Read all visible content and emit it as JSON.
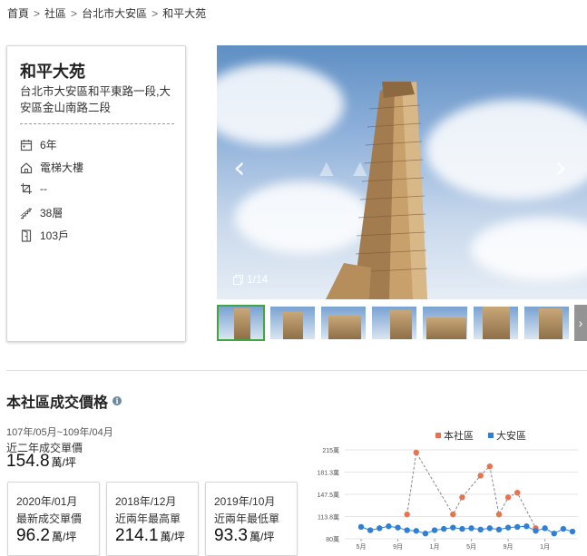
{
  "breadcrumb": [
    {
      "label": "首頁"
    },
    {
      "label": "社區"
    },
    {
      "label": "台北市大安區"
    },
    {
      "label": "和平大苑"
    }
  ],
  "breadcrumb_sep": ">",
  "community": {
    "name": "和平大苑",
    "address": "台北市大安區和平東路一段,大安區金山南路二段",
    "attributes": [
      {
        "icon": "calendar-icon",
        "value": "6年"
      },
      {
        "icon": "house-icon",
        "value": "電梯大樓"
      },
      {
        "icon": "crop-icon",
        "value": "--"
      },
      {
        "icon": "stairs-icon",
        "value": "38層"
      },
      {
        "icon": "door-icon",
        "value": "103戶"
      }
    ]
  },
  "gallery": {
    "counter": "1/14",
    "prev_icon": "chevron-left-icon",
    "next_icon": "chevron-right-icon",
    "thumbnail_count": 7
  },
  "price_section": {
    "title": "本社區成交價格",
    "period": "107年/05月~109年/04月",
    "recent_label": "近二年成交單價",
    "recent_value": "154.8",
    "unit": "萬/坪",
    "boxes": [
      {
        "date": "2020年/01月",
        "label": "最新成交單價",
        "value": "96.2"
      },
      {
        "date": "2018年/12月",
        "label": "近兩年最高單",
        "value": "214.1"
      },
      {
        "date": "2019年/10月",
        "label": "近兩年最低單",
        "value": "93.3"
      }
    ]
  },
  "colors": {
    "community_series": "#e8734f",
    "district_series": "#2f7fd6",
    "active_thumb": "#3fa642"
  },
  "chart_data": {
    "type": "line",
    "legend": [
      "本社區",
      "大安區"
    ],
    "legend_position": "top-right",
    "yticks": [
      "80萬",
      "113.8萬",
      "147.5萬",
      "181.3萬",
      "215萬"
    ],
    "ylim": [
      80,
      215
    ],
    "xticks": [
      {
        "label": "5月",
        "index": 0
      },
      {
        "label": "9月",
        "index": 4
      },
      {
        "label": "1月",
        "index": 8
      },
      {
        "label": "5月",
        "index": 12
      },
      {
        "label": "9月",
        "index": 16
      },
      {
        "label": "1月",
        "index": 20
      }
    ],
    "grid": true,
    "series": [
      {
        "name": "本社區",
        "points": [
          [
            5,
            117
          ],
          [
            6,
            211
          ],
          [
            10,
            117
          ],
          [
            11,
            143
          ],
          [
            13,
            176
          ],
          [
            14,
            190
          ],
          [
            15,
            117
          ],
          [
            16,
            143
          ],
          [
            17,
            150
          ],
          [
            19,
            96
          ]
        ]
      },
      {
        "name": "大安區",
        "points": [
          [
            0,
            98
          ],
          [
            1,
            93
          ],
          [
            2,
            96
          ],
          [
            3,
            99
          ],
          [
            4,
            97
          ],
          [
            5,
            93
          ],
          [
            6,
            92
          ],
          [
            7,
            88
          ],
          [
            8,
            93
          ],
          [
            9,
            95
          ],
          [
            10,
            97
          ],
          [
            11,
            95
          ],
          [
            12,
            96
          ],
          [
            13,
            94
          ],
          [
            14,
            96
          ],
          [
            15,
            94
          ],
          [
            16,
            97
          ],
          [
            17,
            98
          ],
          [
            18,
            99
          ],
          [
            19,
            92
          ],
          [
            20,
            96
          ],
          [
            21,
            88
          ],
          [
            22,
            95
          ],
          [
            23,
            91
          ]
        ]
      }
    ]
  }
}
